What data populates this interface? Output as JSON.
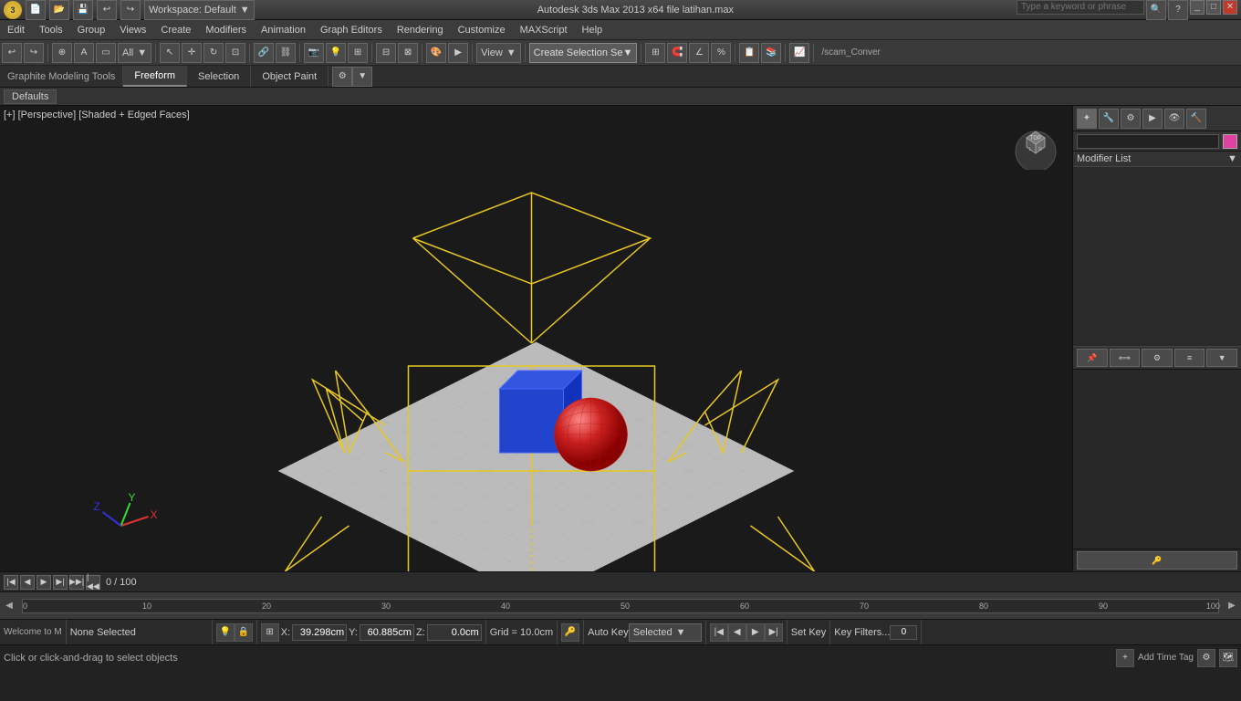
{
  "titlebar": {
    "title": "Autodesk 3ds Max 2013 x64    file latihan.max",
    "workspace": "Workspace: Default",
    "search_placeholder": "Type a keyword or phrase",
    "logo": "3"
  },
  "menubar": {
    "items": [
      "Edit",
      "Tools",
      "Group",
      "Views",
      "Create",
      "Modifiers",
      "Animation",
      "Graph Editors",
      "Rendering",
      "Customize",
      "MAXScript",
      "Help"
    ]
  },
  "toolbar": {
    "filter_label": "All",
    "view_label": "View",
    "create_selection": "Create Selection Se",
    "icons": [
      "undo",
      "redo",
      "select",
      "move",
      "rotate",
      "scale",
      "link",
      "unlink",
      "camera"
    ]
  },
  "graphite_toolbar": {
    "label": "Graphite Modeling Tools",
    "tabs": [
      "Freeform",
      "Selection",
      "Object Paint"
    ],
    "active_tab": "Freeform"
  },
  "defaults_bar": {
    "label": "Defaults"
  },
  "viewport": {
    "label": "[+] [Perspective] [Shaded + Edged Faces]"
  },
  "right_panel": {
    "modifier_list_label": "Modifier List",
    "icons": [
      "pin",
      "link",
      "camera",
      "light",
      "mod",
      "util"
    ],
    "buttons": [
      "push_pin",
      "align",
      "pin2",
      "camera2",
      "filter",
      "settings"
    ]
  },
  "timeline": {
    "frame_range": "0 / 100",
    "markers": [
      "0",
      "10",
      "20",
      "30",
      "40",
      "50",
      "60",
      "70",
      "80",
      "90",
      "100"
    ]
  },
  "statusbar": {
    "none_selected": "None Selected",
    "hint": "Click or click-and-drag to select objects",
    "x_label": "X:",
    "x_value": "39.298cm",
    "y_label": "Y:",
    "y_value": "60.885cm",
    "z_label": "Z:",
    "z_value": "0.0cm",
    "grid_label": "Grid = 10.0cm",
    "auto_key": "Auto Key",
    "selected_label": "Selected",
    "set_key": "Set Key",
    "key_filters": "Key Filters..."
  }
}
